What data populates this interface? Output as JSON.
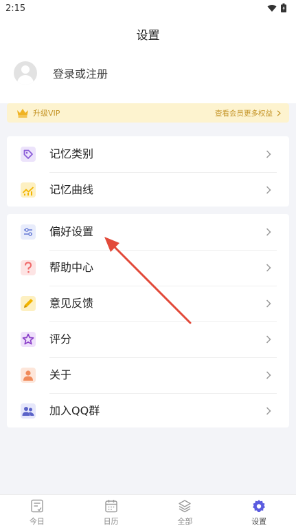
{
  "status_bar": {
    "time": "2:15"
  },
  "header": {
    "title": "设置"
  },
  "profile": {
    "login_text": "登录或注册"
  },
  "vip": {
    "label": "升级VIP",
    "link": "查看会员更多权益"
  },
  "menu_group_1": [
    {
      "label": "记忆类别",
      "icon": "tag-icon",
      "color": "#8a5cd8"
    },
    {
      "label": "记忆曲线",
      "icon": "chart-icon",
      "color": "#f2b400"
    }
  ],
  "menu_group_2": [
    {
      "label": "偏好设置",
      "icon": "sliders-icon",
      "color": "#6b7fd8"
    },
    {
      "label": "帮助中心",
      "icon": "question-icon",
      "color": "#f06a6a"
    },
    {
      "label": "意见反馈",
      "icon": "pencil-icon",
      "color": "#f2b400"
    },
    {
      "label": "评分",
      "icon": "star-icon",
      "color": "#8a3fc8"
    },
    {
      "label": "关于",
      "icon": "person-icon",
      "color": "#f08a5a"
    },
    {
      "label": "加入QQ群",
      "icon": "group-icon",
      "color": "#5b63c8"
    }
  ],
  "bottom_nav": [
    {
      "label": "今日",
      "icon": "today-icon"
    },
    {
      "label": "日历",
      "icon": "calendar-icon"
    },
    {
      "label": "全部",
      "icon": "layers-icon"
    },
    {
      "label": "设置",
      "icon": "settings-gear-icon",
      "active": true
    }
  ],
  "colors": {
    "accent": "#5b5ce0",
    "vip_text": "#c49325",
    "vip_bg": "#fdf3cf",
    "annotation_arrow": "#e24a3a"
  }
}
